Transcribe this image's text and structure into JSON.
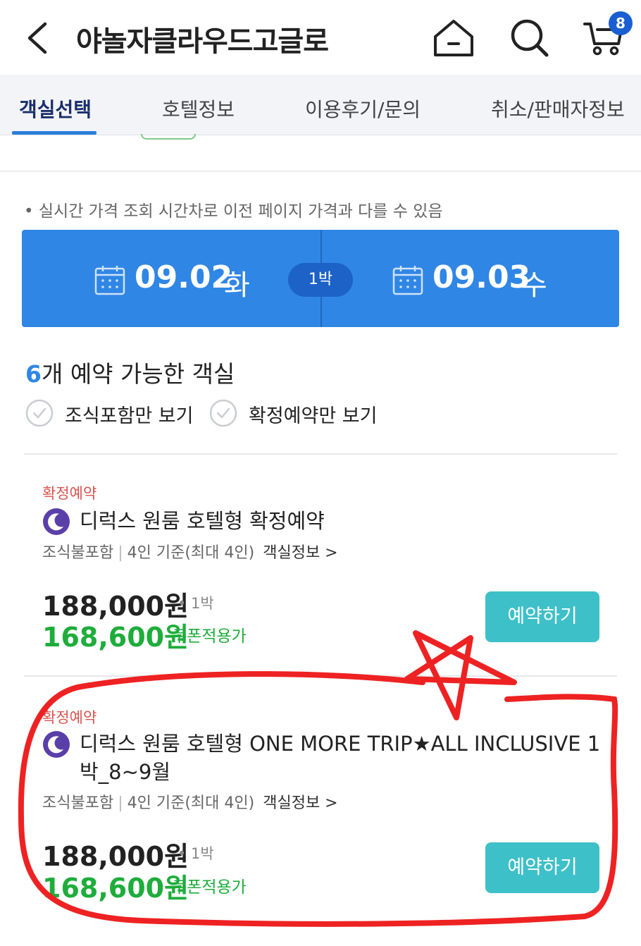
{
  "header": {
    "title": "야놀자클라우드고글로",
    "cart_count": "8"
  },
  "tabs": [
    {
      "label": "객실선택",
      "active": true
    },
    {
      "label": "호텔정보",
      "active": false
    },
    {
      "label": "이용후기/문의",
      "active": false
    },
    {
      "label": "취소/판매자정보",
      "active": false
    }
  ],
  "notice": "• 실시간 가격 조회 시간차로 이전 페이지 가격과 다를 수 있음",
  "dates": {
    "checkin_date": "09.02",
    "checkin_day": "화",
    "nights": "1박",
    "checkout_date": "09.03",
    "checkout_day": "수"
  },
  "availability": {
    "count": "6",
    "text": "개 예약 가능한 객실"
  },
  "filters": [
    {
      "label": "조식포함만 보기",
      "checked": false
    },
    {
      "label": "확정예약만 보기",
      "checked": false
    }
  ],
  "rooms": [
    {
      "badge": "확정예약",
      "name": "디럭스 원룸 호텔형 확정예약",
      "breakfast": "조식불포함",
      "capacity": "4인 기준(최대 4인)",
      "info_link": "객실정보 >",
      "price": "188,000원",
      "nights": "• 1박",
      "sale_price": "168,600원",
      "coupon": "쿠폰적용가",
      "book_label": "예약하기"
    },
    {
      "badge": "확정예약",
      "name": "디럭스 원룸 호텔형 ONE MORE TRIP★ALL INCLUSIVE 1박_8~9월",
      "breakfast": "조식불포함",
      "capacity": "4인 기준(최대 4인)",
      "info_link": "객실정보 >",
      "price": "188,000원",
      "nights": "• 1박",
      "sale_price": "168,600원",
      "coupon": "쿠폰적용가",
      "book_label": "예약하기"
    }
  ],
  "colors": {
    "accent_blue": "#2f86e5",
    "sale_green": "#1ead3b",
    "book_teal": "#3ec0c9",
    "badge_red": "#d9534f",
    "annotation_red": "#ee2222"
  }
}
